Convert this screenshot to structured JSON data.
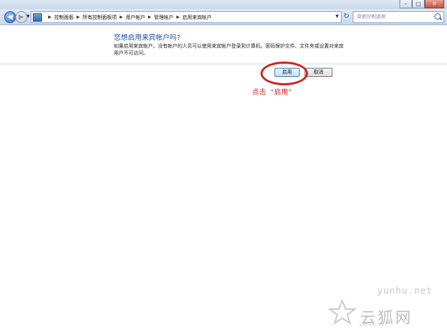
{
  "window": {
    "minimize_glyph": "–",
    "maximize_glyph": "□",
    "close_glyph": "✕"
  },
  "toolbar": {
    "back_glyph": "◀",
    "forward_glyph": "▶",
    "refresh_glyph": "↻",
    "breadcrumbs": [
      "控制面板",
      "所有控制面板项",
      "用户帐户",
      "管理帐户",
      "启用来宾帐户"
    ],
    "search_placeholder": "搜索控制面板"
  },
  "main": {
    "heading": "您想启用来宾帐户吗?",
    "description": "如果启用来宾帐户，没有帐户的人员可以使用来宾帐户登录到计算机。密码保护文件、文件夹或设置对来宾用户不可访问。",
    "enable_button": "启用",
    "cancel_button": "取消"
  },
  "annotation": {
    "text": "点击  “启用”",
    "color": "#d42020"
  },
  "watermark": {
    "domain": "yunhu.net",
    "logo": "云狐网",
    "sub": "yunhu.net"
  },
  "colors": {
    "heading": "#1b4f9c",
    "accent": "#3c7fb1"
  }
}
